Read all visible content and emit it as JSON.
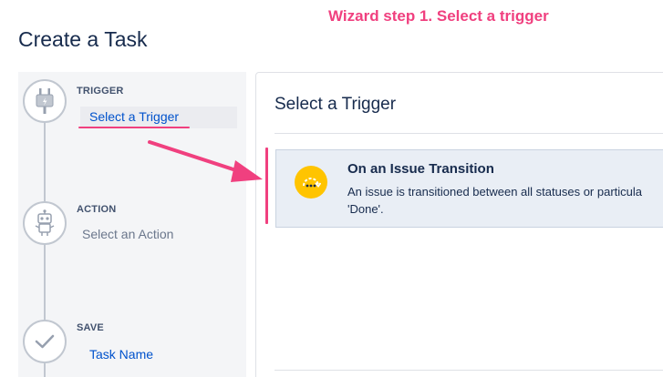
{
  "annotation": {
    "title": "Wizard step 1. Select a trigger"
  },
  "page": {
    "title": "Create a Task"
  },
  "sidebar": {
    "steps": [
      {
        "label": "TRIGGER",
        "value": "Select a Trigger",
        "icon": "plug-icon"
      },
      {
        "label": "ACTION",
        "value": "Select an Action",
        "icon": "robot-icon"
      },
      {
        "label": "SAVE",
        "value": "Task Name",
        "icon": "checkmark-icon"
      }
    ]
  },
  "main": {
    "title": "Select a Trigger",
    "options": [
      {
        "title": "On an Issue Transition",
        "description": "An issue is transitioned between all statuses or particula 'Done'.",
        "icon": "transition-icon"
      }
    ]
  },
  "colors": {
    "annotation": "#f0407f",
    "link": "#0052cc",
    "card_background": "#e9eef5",
    "icon_yellow": "#ffc400",
    "sidebar_background": "#f4f5f7"
  }
}
